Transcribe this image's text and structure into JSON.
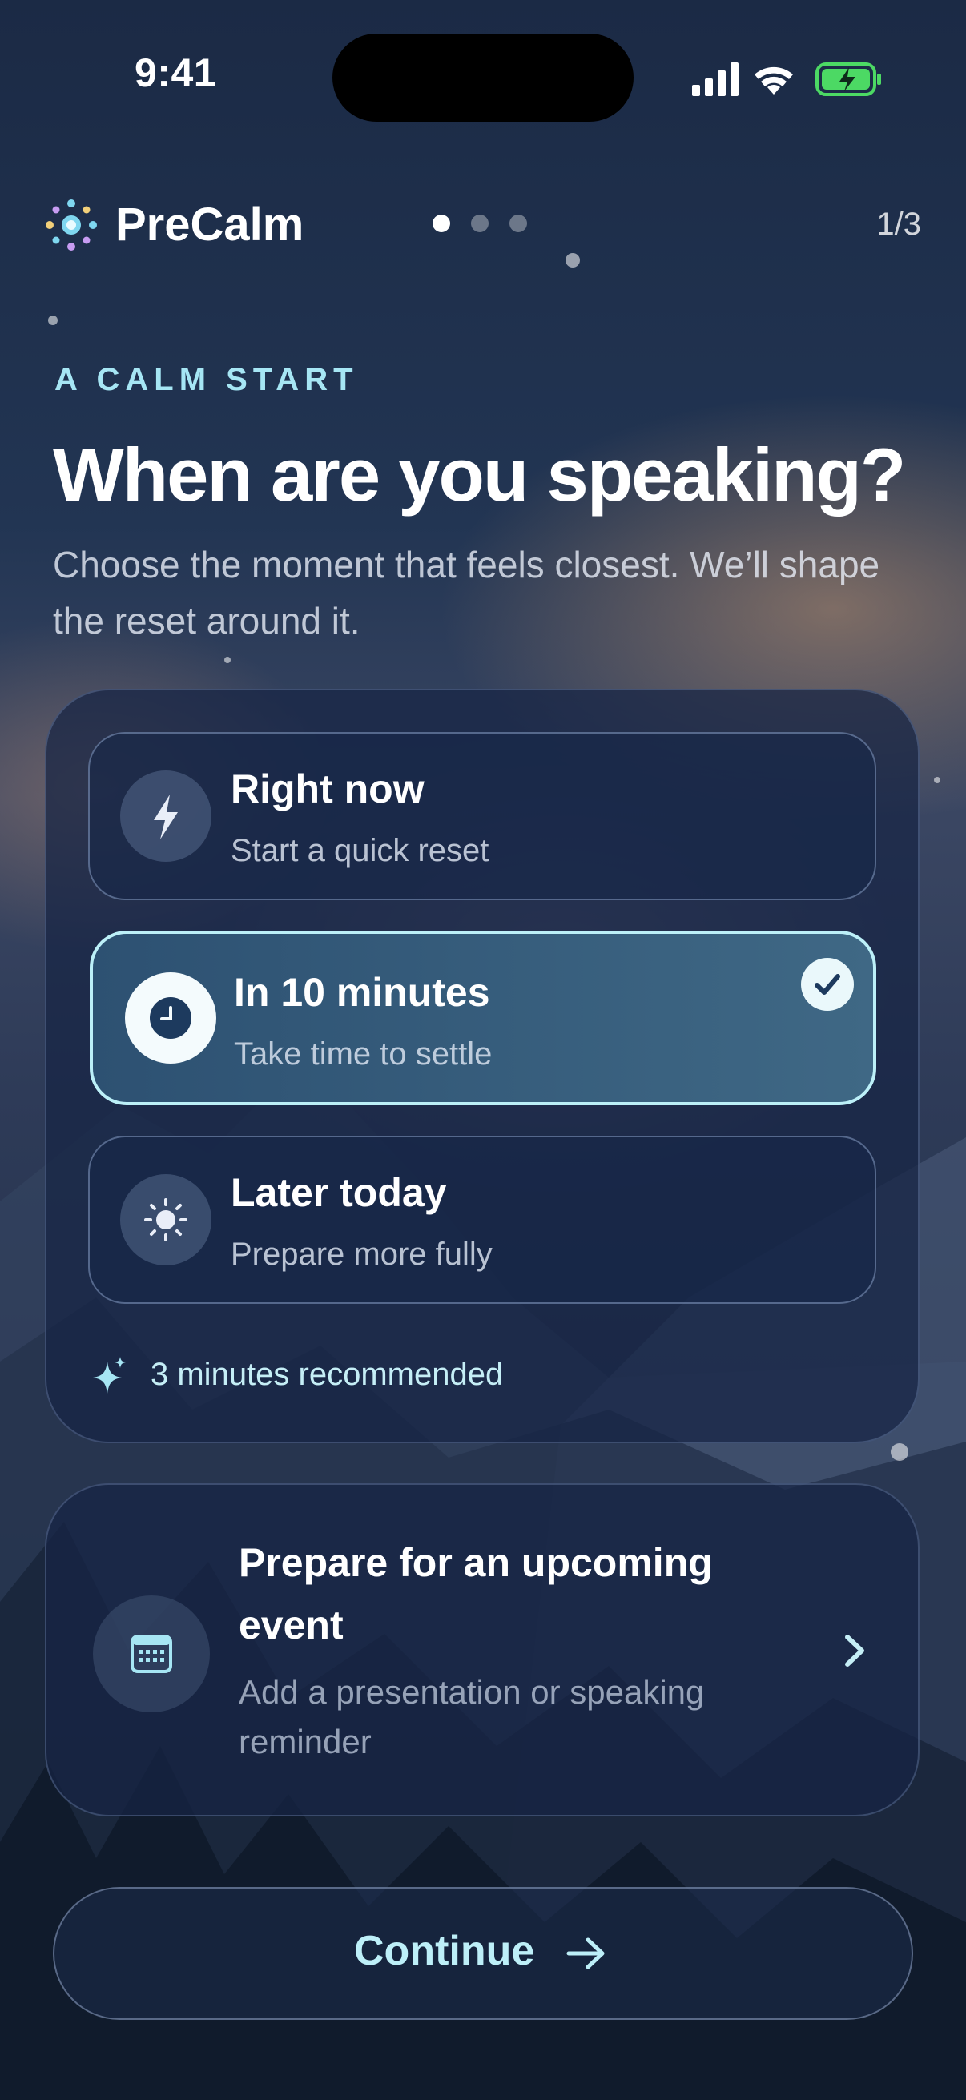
{
  "status_bar": {
    "time": "9:41"
  },
  "header": {
    "brand": "PreCalm",
    "step_indicator": "1/3",
    "progress_dots": 3,
    "active_dot": 1
  },
  "intro": {
    "eyebrow": "A CALM START",
    "title": "When are you speaking?",
    "subtitle": "Choose the moment that feels closest. We’ll shape the reset around it."
  },
  "options": [
    {
      "title": "Right now",
      "subtitle": "Start a quick reset",
      "icon": "lightning-icon",
      "selected": false
    },
    {
      "title": "In 10 minutes",
      "subtitle": "Take time to settle",
      "icon": "clock-icon",
      "selected": true
    },
    {
      "title": "Later today",
      "subtitle": "Prepare more fully",
      "icon": "sun-icon",
      "selected": false
    }
  ],
  "recommendation": {
    "icon": "sparkle-icon",
    "text": "3 minutes recommended"
  },
  "event_card": {
    "icon": "calendar-icon",
    "title": "Prepare for an upcoming event",
    "subtitle": "Add a presentation or speaking reminder"
  },
  "continue_button": {
    "label": "Continue",
    "icon": "arrow-right-icon"
  },
  "colors": {
    "accent": "#bcf0f8",
    "eyebrow": "#a6e6f4",
    "battery": "#4cd964"
  }
}
